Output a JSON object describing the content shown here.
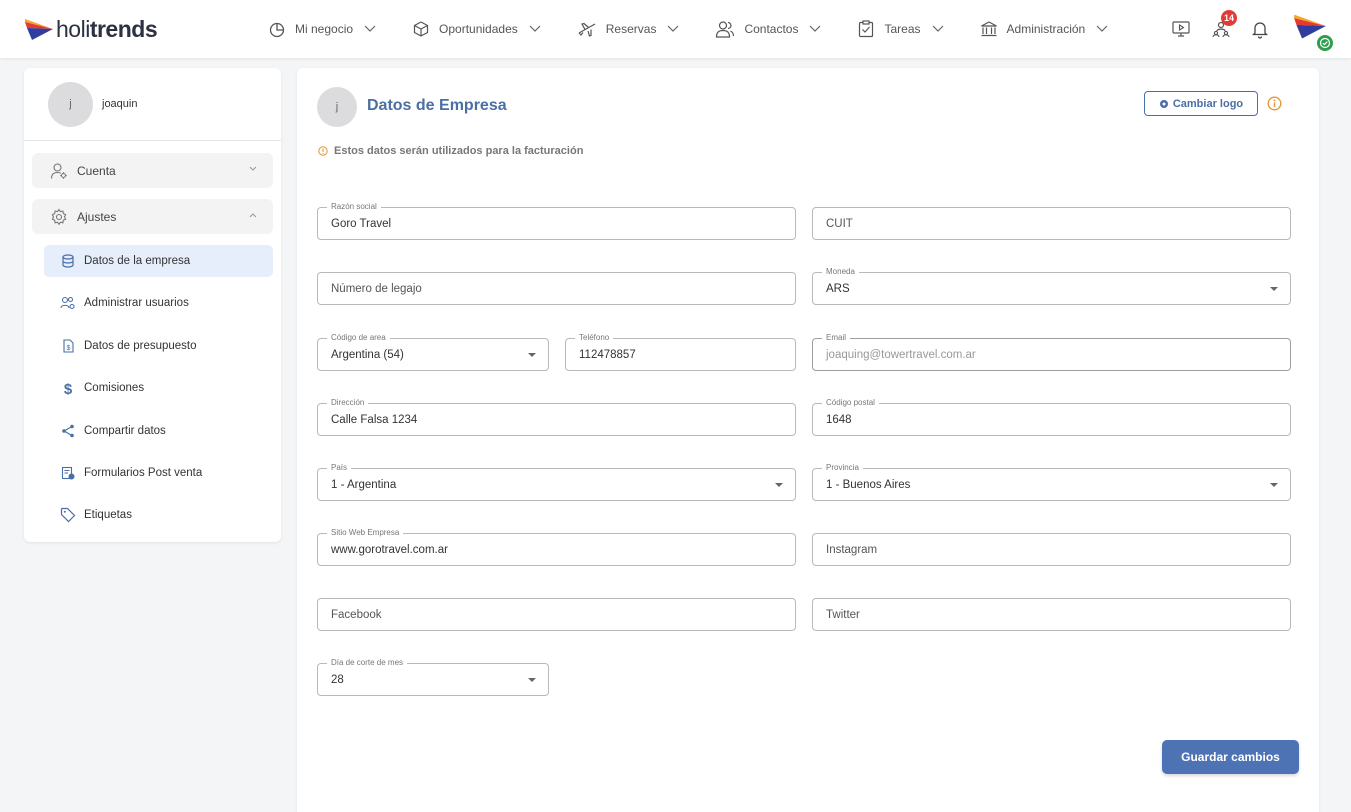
{
  "brand": {
    "logo_light": "holi",
    "logo_bold": "trends"
  },
  "nav": [
    {
      "label": "Mi negocio",
      "icon": "pie-chart-icon"
    },
    {
      "label": "Oportunidades",
      "icon": "cube-icon"
    },
    {
      "label": "Reservas",
      "icon": "airplane-icon"
    },
    {
      "label": "Contactos",
      "icon": "users-icon"
    },
    {
      "label": "Tareas",
      "icon": "clipboard-check-icon"
    },
    {
      "label": "Administración",
      "icon": "bank-icon"
    }
  ],
  "header": {
    "notifications_badge": "14"
  },
  "sidebar": {
    "user": {
      "initial": "j",
      "name": "joaquin"
    },
    "sections": [
      {
        "label": "Cuenta",
        "icon": "user-gear-icon"
      },
      {
        "label": "Ajustes",
        "icon": "gear-icon"
      }
    ],
    "items": [
      {
        "label": "Datos de la empresa",
        "icon": "database-icon",
        "active": true
      },
      {
        "label": "Administrar usuarios",
        "icon": "users-gear-icon"
      },
      {
        "label": "Datos de presupuesto",
        "icon": "document-money-icon"
      },
      {
        "label": "Comisiones",
        "icon": "dollar-icon"
      },
      {
        "label": "Compartir datos",
        "icon": "share-icon"
      },
      {
        "label": "Formularios Post venta",
        "icon": "form-icon"
      },
      {
        "label": "Etiquetas",
        "icon": "tag-icon"
      }
    ]
  },
  "main": {
    "initial": "j",
    "title": "Datos de Empresa",
    "change_logo_label": "Cambiar logo",
    "note": "Estos datos serán utilizados para la facturación",
    "save_label": "Guardar cambios",
    "fields": {
      "razon_social": {
        "label": "Razón social",
        "value": "Goro Travel"
      },
      "cuit": {
        "placeholder": "CUIT"
      },
      "legajo": {
        "placeholder": "Número de legajo"
      },
      "moneda": {
        "label": "Moneda",
        "value": "ARS"
      },
      "codigo_area": {
        "label": "Código de area",
        "value": "Argentina (54)"
      },
      "telefono": {
        "label": "Teléfono",
        "value": "112478857"
      },
      "email": {
        "label": "Email",
        "value": "joaquing@towertravel.com.ar"
      },
      "direccion": {
        "label": "Dirección",
        "value": "Calle Falsa 1234"
      },
      "codigo_postal": {
        "label": "Código postal",
        "value": "1648"
      },
      "pais": {
        "label": "País",
        "value": "1 - Argentina"
      },
      "provincia": {
        "label": "Provincia",
        "value": "1 - Buenos Aires"
      },
      "sitio_web": {
        "label": "Sitio Web Empresa",
        "value": "www.gorotravel.com.ar"
      },
      "instagram": {
        "placeholder": "Instagram"
      },
      "facebook": {
        "placeholder": "Facebook"
      },
      "twitter": {
        "placeholder": "Twitter"
      },
      "dia_corte": {
        "label": "Día de corte de mes",
        "value": "28"
      }
    }
  },
  "colors": {
    "accent": "#4a6fa5",
    "button": "#4e73b5",
    "badge": "#e53935",
    "warning": "#e8932d",
    "success": "#2e9e4a",
    "active_bg": "#e6eefb"
  }
}
